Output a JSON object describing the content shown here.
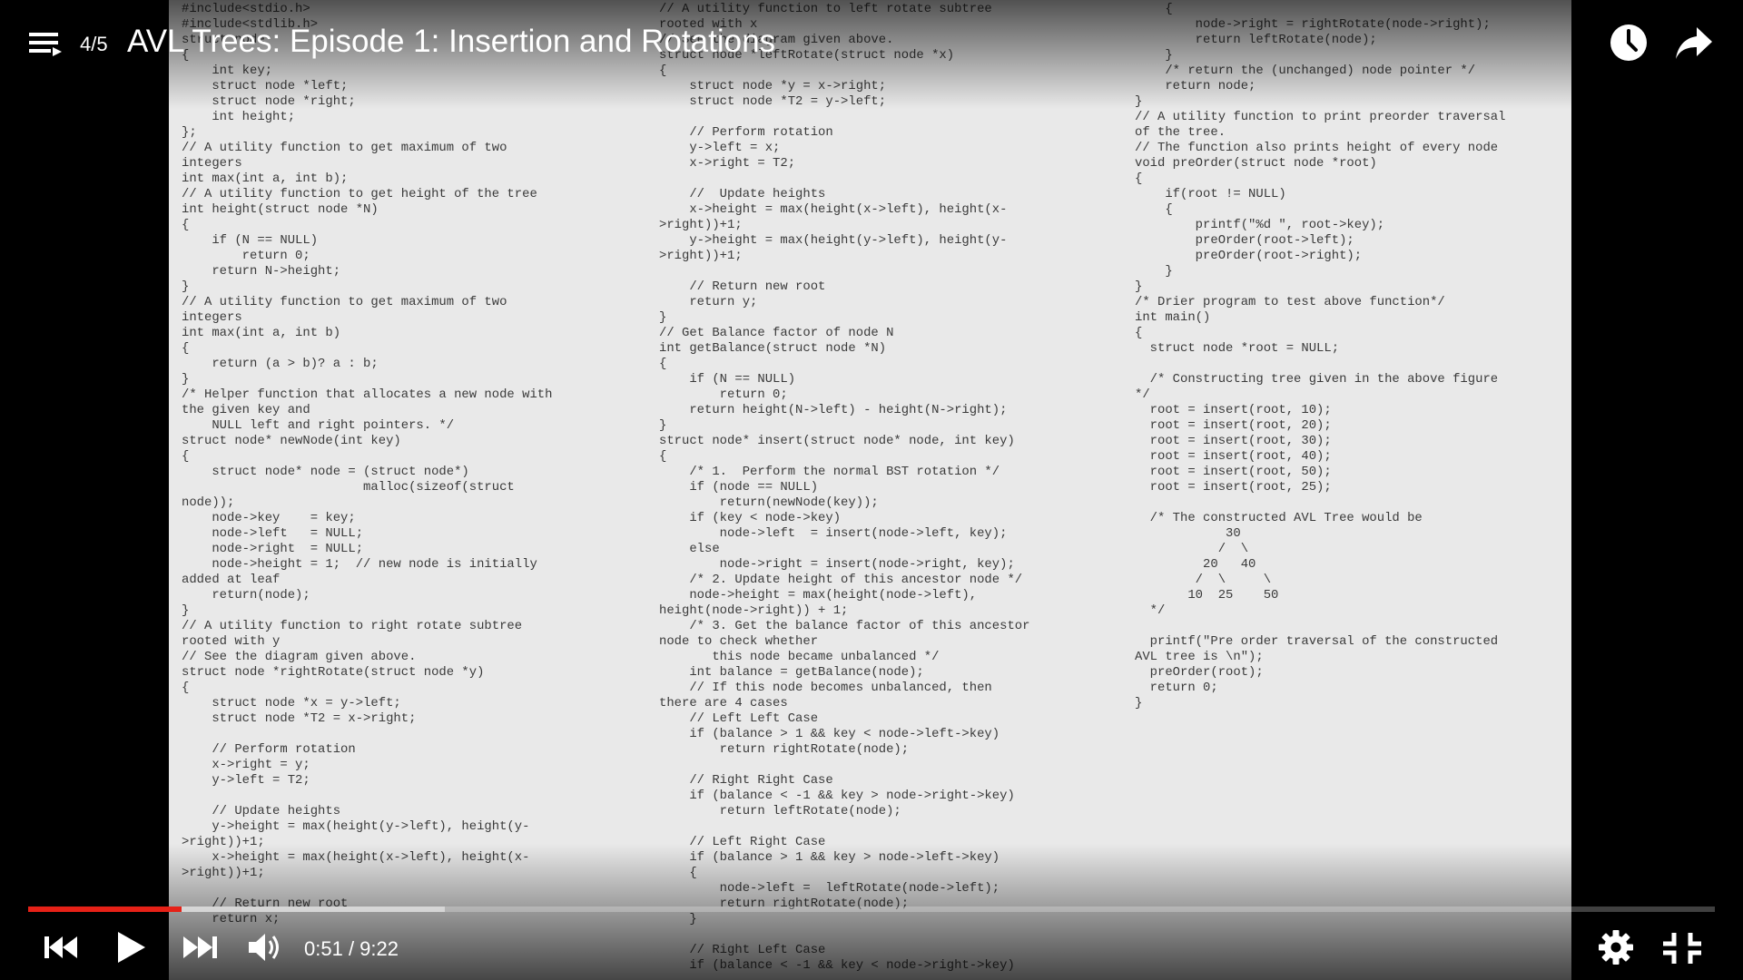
{
  "header": {
    "playlist_position": "4/5",
    "title": "AVL Trees: Episode 1: Insertion and Rotations"
  },
  "player": {
    "current_time": "0:51",
    "separator": " / ",
    "duration": "9:22",
    "progress_fraction": 0.091,
    "buffered_fraction": 0.247,
    "accent_color": "#e62117"
  },
  "icons": {
    "playlist": "playlist-icon",
    "watch_later": "clock-icon",
    "share": "share-arrow-icon",
    "previous": "skip-previous-icon",
    "play": "play-icon",
    "next": "skip-next-icon",
    "volume": "volume-icon",
    "settings": "gear-icon",
    "fullscreen_exit": "fullscreen-exit-icon"
  },
  "video_frame": {
    "code_columns": [
      "#include<stdio.h>\n#include<stdlib.h>\nstruct node\n{\n    int key;\n    struct node *left;\n    struct node *right;\n    int height;\n};\n// A utility function to get maximum of two\nintegers\nint max(int a, int b);\n// A utility function to get height of the tree\nint height(struct node *N)\n{\n    if (N == NULL)\n        return 0;\n    return N->height;\n}\n// A utility function to get maximum of two\nintegers\nint max(int a, int b)\n{\n    return (a > b)? a : b;\n}\n/* Helper function that allocates a new node with\nthe given key and\n    NULL left and right pointers. */\nstruct node* newNode(int key)\n{\n    struct node* node = (struct node*)\n                        malloc(sizeof(struct\nnode));\n    node->key    = key;\n    node->left   = NULL;\n    node->right  = NULL;\n    node->height = 1;  // new node is initially\nadded at leaf\n    return(node);\n}\n// A utility function to right rotate subtree\nrooted with y\n// See the diagram given above.\nstruct node *rightRotate(struct node *y)\n{\n    struct node *x = y->left;\n    struct node *T2 = x->right;\n\n    // Perform rotation\n    x->right = y;\n    y->left = T2;\n\n    // Update heights\n    y->height = max(height(y->left), height(y-\n>right))+1;\n    x->height = max(height(x->left), height(x-\n>right))+1;\n\n    // Return new root\n    return x;",
      "// A utility function to left rotate subtree\nrooted with x\n// See the diagram given above.\nstruct node *leftRotate(struct node *x)\n{\n    struct node *y = x->right;\n    struct node *T2 = y->left;\n\n    // Perform rotation\n    y->left = x;\n    x->right = T2;\n\n    //  Update heights\n    x->height = max(height(x->left), height(x-\n>right))+1;\n    y->height = max(height(y->left), height(y-\n>right))+1;\n\n    // Return new root\n    return y;\n}\n// Get Balance factor of node N\nint getBalance(struct node *N)\n{\n    if (N == NULL)\n        return 0;\n    return height(N->left) - height(N->right);\n}\nstruct node* insert(struct node* node, int key)\n{\n    /* 1.  Perform the normal BST rotation */\n    if (node == NULL)\n        return(newNode(key));\n    if (key < node->key)\n        node->left  = insert(node->left, key);\n    else\n        node->right = insert(node->right, key);\n    /* 2. Update height of this ancestor node */\n    node->height = max(height(node->left),\nheight(node->right)) + 1;\n    /* 3. Get the balance factor of this ancestor\nnode to check whether\n       this node became unbalanced */\n    int balance = getBalance(node);\n    // If this node becomes unbalanced, then\nthere are 4 cases\n    // Left Left Case\n    if (balance > 1 && key < node->left->key)\n        return rightRotate(node);\n\n    // Right Right Case\n    if (balance < -1 && key > node->right->key)\n        return leftRotate(node);\n\n    // Left Right Case\n    if (balance > 1 && key > node->left->key)\n    {\n        node->left =  leftRotate(node->left);\n        return rightRotate(node);\n    }\n\n    // Right Left Case\n    if (balance < -1 && key < node->right->key)",
      "    {\n        node->right = rightRotate(node->right);\n        return leftRotate(node);\n    }\n    /* return the (unchanged) node pointer */\n    return node;\n}\n// A utility function to print preorder traversal\nof the tree.\n// The function also prints height of every node\nvoid preOrder(struct node *root)\n{\n    if(root != NULL)\n    {\n        printf(\"%d \", root->key);\n        preOrder(root->left);\n        preOrder(root->right);\n    }\n}\n/* Drier program to test above function*/\nint main()\n{\n  struct node *root = NULL;\n\n  /* Constructing tree given in the above figure\n*/\n  root = insert(root, 10);\n  root = insert(root, 20);\n  root = insert(root, 30);\n  root = insert(root, 40);\n  root = insert(root, 50);\n  root = insert(root, 25);\n\n  /* The constructed AVL Tree would be\n            30\n           /  \\\n         20   40\n        /  \\     \\\n       10  25    50\n  */\n\n  printf(\"Pre order traversal of the constructed\nAVL tree is \\n\");\n  preOrder(root);\n  return 0;\n}"
    ]
  }
}
